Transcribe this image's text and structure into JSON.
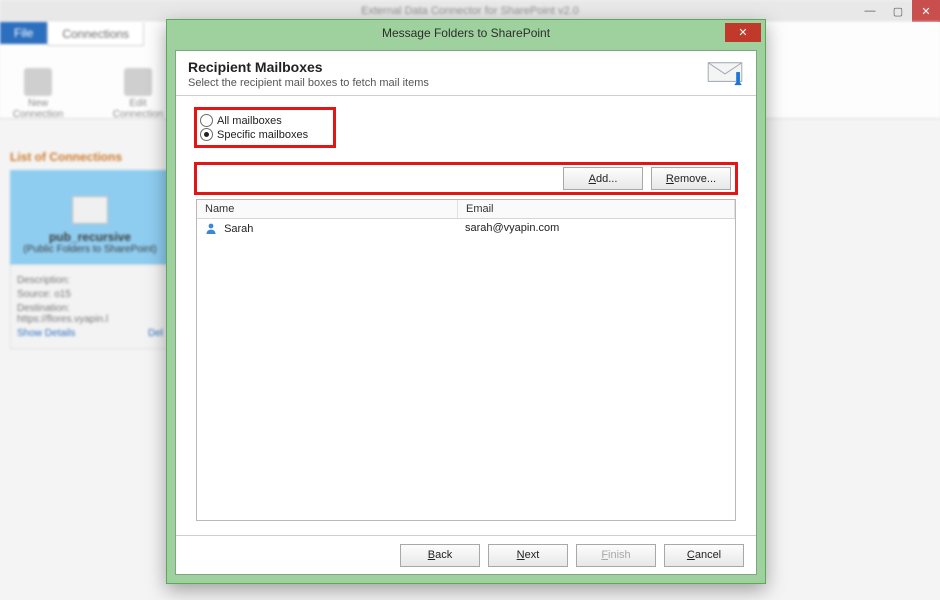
{
  "bg": {
    "title": "External Data Connector for SharePoint v2.0",
    "tabs": {
      "file": "File",
      "connections": "Connections"
    },
    "ribbon": {
      "new": "New Connection",
      "edit": "Edit Connection"
    },
    "panel_title": "List of Connections",
    "card": {
      "name": "pub_recursive",
      "sub": "(Public Folders to SharePoint)"
    },
    "meta": {
      "desc": "Description:",
      "src": "Source: o15",
      "dest": "Destination: https://flores.vyapin.l",
      "show": "Show Details",
      "del": "Del"
    }
  },
  "dialog": {
    "title": "Message Folders to SharePoint",
    "close": "✕",
    "header_title": "Recipient Mailboxes",
    "header_sub": "Select the recipient mail boxes to fetch mail items",
    "icon": "mail-upload-icon"
  },
  "radios": {
    "all": "All mailboxes",
    "specific": "Specific mailboxes",
    "selected": "specific"
  },
  "actions": {
    "add": "Add...",
    "remove": "Remove..."
  },
  "grid": {
    "columns": {
      "name": "Name",
      "email": "Email"
    },
    "rows": [
      {
        "name": "Sarah",
        "email": "sarah@vyapin.com"
      }
    ]
  },
  "wizard": {
    "back": "Back",
    "next": "Next",
    "finish": "Finish",
    "cancel": "Cancel"
  }
}
